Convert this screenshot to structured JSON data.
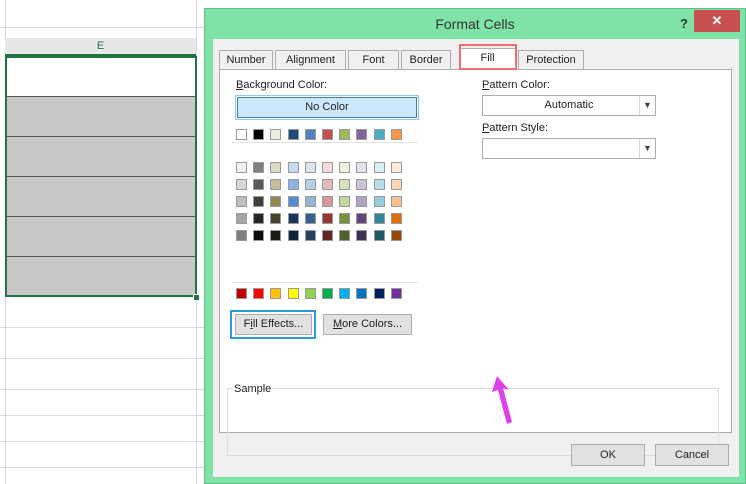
{
  "spreadsheet": {
    "column_header": "E"
  },
  "dialog": {
    "title": "Format Cells",
    "help_label": "?",
    "close_label": "✕",
    "tabs": [
      {
        "label": "Number"
      },
      {
        "label": "Alignment"
      },
      {
        "label": "Font"
      },
      {
        "label": "Border"
      },
      {
        "label": "Fill",
        "active": true
      },
      {
        "label": "Protection"
      }
    ],
    "background_color_label": "Background Color:",
    "no_color_label": "No Color",
    "theme_colors_top": [
      "#ffffff",
      "#000000",
      "#eeece1",
      "#1f497d",
      "#4f81bd",
      "#c0504d",
      "#9bbb59",
      "#8064a2",
      "#4bacc6",
      "#f79646"
    ],
    "theme_colors_grid": [
      [
        "#f2f2f2",
        "#7f7f7f",
        "#ddd9c3",
        "#c6d9f0",
        "#dbe5f1",
        "#f2dcdb",
        "#ebf1dd",
        "#e5e0ec",
        "#dbeef3",
        "#fdeada"
      ],
      [
        "#d8d8d8",
        "#595959",
        "#c4bd97",
        "#8db3e2",
        "#b8cce4",
        "#e5b9b7",
        "#d7e3bc",
        "#ccc1d9",
        "#b7dde8",
        "#fbd5b5"
      ],
      [
        "#bfbfbf",
        "#3f3f3f",
        "#938953",
        "#548dd4",
        "#95b3d7",
        "#d99694",
        "#c3d69b",
        "#b2a2c7",
        "#92cddc",
        "#fac08f"
      ],
      [
        "#a5a5a5",
        "#262626",
        "#494429",
        "#17365d",
        "#366092",
        "#953734",
        "#76923c",
        "#5f497a",
        "#31859b",
        "#e36c09"
      ],
      [
        "#7f7f7f",
        "#0c0c0c",
        "#1d1b10",
        "#0f243e",
        "#244061",
        "#632423",
        "#4f6128",
        "#3f3151",
        "#205867",
        "#974806"
      ]
    ],
    "standard_colors": [
      "#c00000",
      "#ff0000",
      "#ffc000",
      "#ffff00",
      "#92d050",
      "#00b050",
      "#00b0f0",
      "#0070c0",
      "#002060",
      "#7030a0"
    ],
    "fill_effects_label": "Fill Effects...",
    "more_colors_label": "More Colors...",
    "pattern_color_label": "Pattern Color:",
    "pattern_color_value": "Automatic",
    "pattern_style_label": "Pattern Style:",
    "pattern_style_value": "",
    "sample_label": "Sample",
    "ok_label": "OK",
    "cancel_label": "Cancel"
  },
  "colors": {
    "dialog_frame": "#7fe3a8",
    "tab_highlight": "#f06b7c",
    "button_highlight": "#2a9bd4",
    "annotation_arrow": "#e040e8",
    "excel_green": "#217346"
  }
}
